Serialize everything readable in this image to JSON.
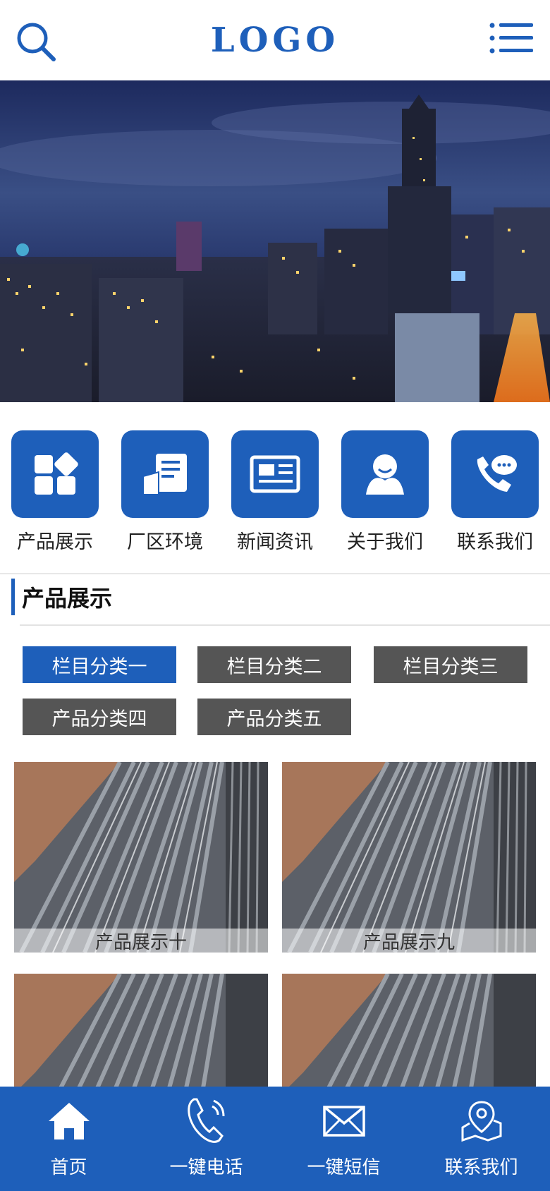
{
  "header": {
    "logo_text": "LOGO",
    "search_icon": "search-icon",
    "menu_icon": "menu-icon"
  },
  "banner": {
    "image": "night-city-skyline"
  },
  "quick_nav": [
    {
      "label": "产品展示",
      "icon": "grid-icon"
    },
    {
      "label": "厂区环境",
      "icon": "document-icon"
    },
    {
      "label": "新闻资讯",
      "icon": "newspaper-icon"
    },
    {
      "label": "关于我们",
      "icon": "person-icon"
    },
    {
      "label": "联系我们",
      "icon": "phone-chat-icon"
    }
  ],
  "section": {
    "title": "产品展示"
  },
  "categories": [
    {
      "label": "栏目分类一",
      "active": true
    },
    {
      "label": "栏目分类二",
      "active": false
    },
    {
      "label": "栏目分类三",
      "active": false
    },
    {
      "label": "产品分类四",
      "active": false
    },
    {
      "label": "产品分类五",
      "active": false
    }
  ],
  "products": [
    {
      "caption": "产品展示十",
      "image": "steel-rebar-bundle"
    },
    {
      "caption": "产品展示九",
      "image": "steel-rebar-bundle"
    },
    {
      "caption": "",
      "image": "steel-rebar-bundle"
    },
    {
      "caption": "",
      "image": "steel-rebar-bundle"
    }
  ],
  "bottom_bar": [
    {
      "label": "首页",
      "icon": "home-icon"
    },
    {
      "label": "一键电话",
      "icon": "phone-icon"
    },
    {
      "label": "一键短信",
      "icon": "mail-icon"
    },
    {
      "label": "联系我们",
      "icon": "map-pin-icon"
    }
  ],
  "colors": {
    "brand": "#1e5fba",
    "tab_inactive": "#555555"
  }
}
